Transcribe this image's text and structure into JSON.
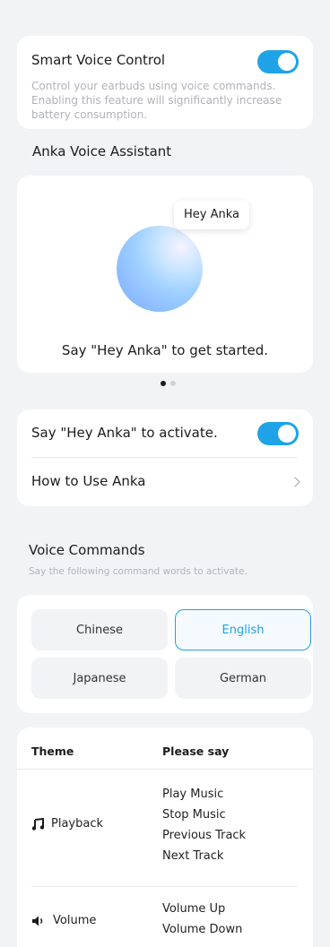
{
  "statusbar": {
    "clipped_text": ""
  },
  "smart_voice": {
    "title": "Smart Voice Control",
    "description": "Control your earbuds using voice commands. Enabling this feature will significantly increase battery consumption.",
    "enabled": true
  },
  "assistant": {
    "section_title": "Anka Voice Assistant",
    "bubble": "Hey Anka",
    "caption": "Say \"Hey Anka\" to get started.",
    "page_index": 1,
    "page_count": 2
  },
  "settings": {
    "activate_label": "Say \"Hey Anka\" to activate.",
    "activate_enabled": true,
    "how_to_label": "How to Use Anka"
  },
  "commands": {
    "title": "Voice Commands",
    "subtitle": "Say the following command words to activate.",
    "languages": [
      {
        "label": "Chinese",
        "active": false
      },
      {
        "label": "English",
        "active": true
      },
      {
        "label": "Japanese",
        "active": false
      },
      {
        "label": "German",
        "active": false
      }
    ]
  },
  "table": {
    "col_theme": "Theme",
    "col_say": "Please say",
    "rows": [
      {
        "theme": "Playback",
        "icon": "music-note-icon",
        "phrases": [
          "Play Music",
          "Stop Music",
          "Previous Track",
          "Next Track"
        ]
      },
      {
        "theme": "Volume",
        "icon": "speaker-icon",
        "phrases": [
          "Volume Up",
          "Volume Down"
        ]
      }
    ]
  },
  "colors": {
    "accent": "#1fa3e6",
    "background": "#f2f3f5"
  }
}
